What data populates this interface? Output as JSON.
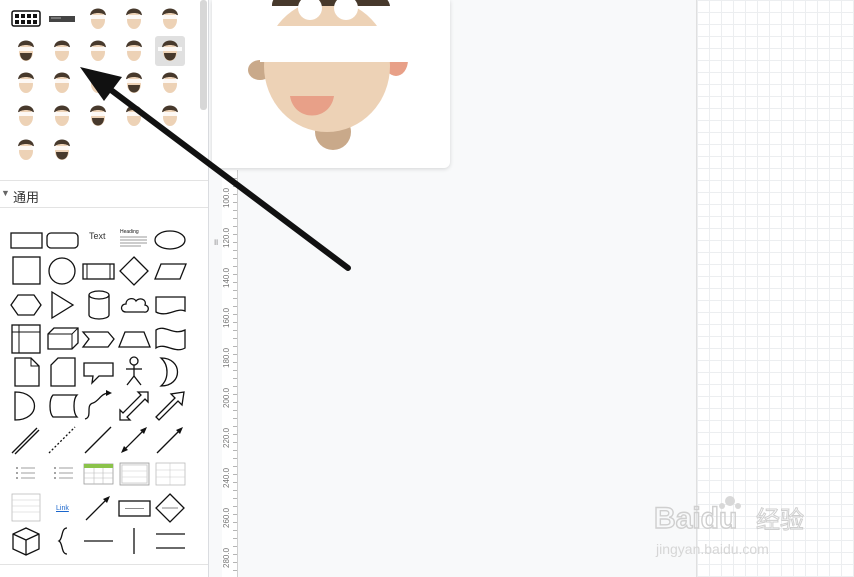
{
  "sidebar": {
    "section_title": "通用",
    "text_shape_label": "Text",
    "heading_label": "Heading",
    "link_label": "Link",
    "splitter_glyph": "॥",
    "avatar_rows": 5,
    "avatar_cols": 5
  },
  "ruler": {
    "labels": [
      "100.0",
      "120.0",
      "140.0",
      "160.0",
      "180.0",
      "200.0",
      "220.0",
      "240.0",
      "260.0",
      "280.0"
    ]
  },
  "colors": {
    "hair": "#47392c",
    "skin": "#edd2b6",
    "cheek": "#e8a088",
    "canvas_bg": "#f8f9fa"
  },
  "watermark": {
    "brand": "Baidu",
    "cn": "经验",
    "url": "jingyan.baidu.com"
  }
}
